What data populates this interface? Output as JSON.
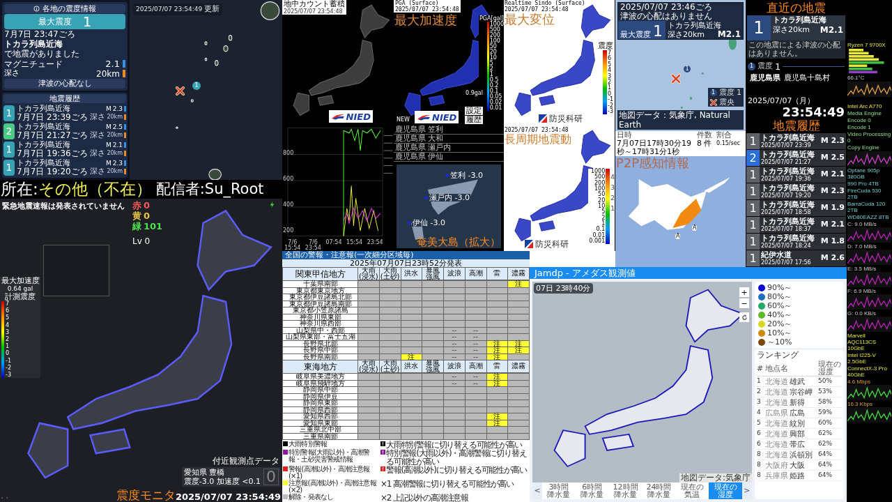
{
  "quake_panel": {
    "header": "各地の震度情報",
    "max_intensity_label": "最大震度",
    "max_intensity": "1",
    "time": "7月7日 23:47ごろ",
    "region": "トカラ列島近海",
    "note": "で地震がありました",
    "magnitude_label": "マグニチュード",
    "magnitude": "2.1",
    "depth_label": "深さ",
    "depth": "20km",
    "tsunami": "津波の心配なし",
    "history_header": "地震履歴",
    "history": [
      {
        "intensity": "1",
        "color": "#37a3b5",
        "region": "トカラ列島近海",
        "time": "7月7日 23:39ごろ",
        "depth_label": "深さ",
        "depth": "20km",
        "magnitude_label": "M",
        "magnitude": "2.3"
      },
      {
        "intensity": "2",
        "color": "#4cc985",
        "region": "トカラ列島近海",
        "time": "7月7日 21:27ごろ",
        "depth_label": "深さ",
        "depth": "20km",
        "magnitude_label": "M",
        "magnitude": "2.5"
      },
      {
        "intensity": "1",
        "color": "#37a3b5",
        "region": "トカラ列島近海",
        "time": "7月7日 19:36ごろ",
        "depth_label": "深さ",
        "depth": "20km",
        "magnitude_label": "M",
        "magnitude": "2.1"
      },
      {
        "intensity": "1",
        "color": "#37a3b5",
        "region": "トカラ列島近海",
        "time": "7月7日 19:20ごろ",
        "depth_label": "深さ",
        "depth": "20km",
        "magnitude_label": "M",
        "magnitude": "2.3"
      }
    ],
    "map_timestamp": "2025/07/07 23:54:49",
    "map_timestamp_suffix": "更新",
    "station_marker": "1"
  },
  "banner": {
    "label": "所在:",
    "status": "その他（不在）",
    "streamer": "配信者:Su_Root"
  },
  "shindo_monitor": {
    "eew_status": "緊急地震速報は発表されていません",
    "counts": [
      {
        "label": "赤",
        "value": "0",
        "color": "#ff5a5a"
      },
      {
        "label": "黄",
        "value": "0",
        "color": "#e8c547"
      },
      {
        "label": "緑",
        "value": "101",
        "color": "#4ee04e"
      }
    ],
    "level": "Lv 0",
    "max_accel_label": "最大加速度",
    "max_accel": "0.64 gal",
    "scale_label": "計測震度",
    "scale_ticks": [
      "7",
      "6",
      "5",
      "4",
      "3",
      "2",
      "1",
      "0",
      "-1",
      "-2",
      "-3"
    ],
    "nearby_label": "付近観測点データ",
    "nearby_station": "愛知県 豊橋",
    "nearby_values": "震度-3.0 加速度 <0.1",
    "nearby_intensity": "0",
    "title": "震度モニタ",
    "timestamp": "2025/07/07 23:54:49"
  },
  "underground_count": {
    "title": "地中カウント蓄積",
    "timestamp": "2025/07/07 23:54:48",
    "logo": "NIED",
    "graph_yticks": [
      "800",
      "600",
      "400",
      "200"
    ],
    "graph_xticks": [
      "7/6 15:54",
      "7/6 23:54",
      "07:54",
      "15:54",
      "23:54"
    ]
  },
  "pga": {
    "header": "PGA (Surface)",
    "timestamp": "2025/07/07 23:54:48",
    "title": "最大加速度",
    "legend_title": "PGA[gal]",
    "legend_ticks": [
      "1000",
      "500",
      "200",
      "100",
      "50",
      "20",
      "10",
      "5",
      "2",
      "1",
      "0.5",
      "0.2",
      "0.1",
      "0.05",
      "0.02",
      "0.01"
    ],
    "reading": "0.9gal",
    "new_label": "NEW",
    "buttons": [
      "設定",
      "履歴"
    ],
    "logo": "NIED"
  },
  "amami": {
    "stations": [
      "鹿児島県 笠利",
      "鹿児島県 大和",
      "鹿児島県 瀬戸内",
      "鹿児島県 伊仙"
    ],
    "map_labels": [
      "笠利 -3.0",
      "瀬戸内 -3.0",
      "伊仙 -3.0"
    ],
    "title": "奄美大島（拡大）"
  },
  "realtime_sindo": {
    "header": "Realtime Sindo (Surface)",
    "timestamp": "2025/07/07 23:54:48",
    "title": "最大変位",
    "legend_title": "震度",
    "legend_ticks": [
      "7",
      "6",
      "5",
      "4",
      "3",
      "2",
      "1",
      "0",
      "-1",
      "-2",
      "-3"
    ],
    "logo": "防災科研"
  },
  "long_period": {
    "timestamp": "2025/07/07 23:54:48",
    "title": "長周期地震動",
    "legend_ticks": [
      "1000",
      "500",
      "200",
      "100",
      "50",
      "20",
      "10",
      "5",
      "2",
      "1",
      "0.1",
      "0.01",
      "0.001"
    ],
    "class_ticks": [
      "4",
      "3",
      "2",
      "1"
    ],
    "logo": "防災科研"
  },
  "epicenter_map": {
    "time": "2025/07/07 23:46ごろ",
    "tsunami": "津波の心配はありません",
    "max_intensity_label": "最大震度",
    "max_intensity": "1",
    "region": "トカラ列島近海",
    "depth": "深さ20km",
    "magnitude": "M2.1",
    "station_marker": "1",
    "legend": [
      {
        "kind": "intensity",
        "marker": "1",
        "label": "震度 1"
      },
      {
        "kind": "epicenter",
        "label": "震央"
      }
    ],
    "attribution": "地図データ：気象庁, Natural Earth"
  },
  "p2p": {
    "columns": [
      "日時",
      "件数",
      "割合"
    ],
    "values": [
      "7月07日17時30分19秒～17時31分1秒",
      "8 件",
      "0.15/sec"
    ],
    "title": "P2P感知情報",
    "markers": [
      "A",
      "A"
    ]
  },
  "recent": {
    "title": "直近の地震",
    "intensity": "1",
    "region": "トカラ列島近海",
    "depth": "深さ20km",
    "magnitude": "M2.1",
    "message": "この地震による津波の心配はありません。",
    "area": {
      "marker": "1",
      "label": "震度",
      "intensity": "1",
      "prefecture": "鹿児島県",
      "city": "鹿児島十島村"
    },
    "date": "2025/07/07（月）",
    "time": "23:54:49",
    "history_title": "地震履歴",
    "history": [
      {
        "intensity": "1",
        "color": "#5f6368",
        "region": "トカラ列島近海",
        "datetime": "2025/07/07 23:39",
        "magnitude": "M 2.3"
      },
      {
        "intensity": "2",
        "color": "#2a6fd6",
        "region": "トカラ列島近海",
        "datetime": "2025/07/07 21:27",
        "magnitude": "M 2.5"
      },
      {
        "intensity": "1",
        "color": "#5f6368",
        "region": "トカラ列島近海",
        "datetime": "2025/07/07 19:36",
        "magnitude": "M 2.1"
      },
      {
        "intensity": "1",
        "color": "#5f6368",
        "region": "トカラ列島近海",
        "datetime": "2025/07/07 19:20",
        "magnitude": "M 2.3"
      },
      {
        "intensity": "1",
        "color": "#5f6368",
        "region": "トカラ列島近海",
        "datetime": "2025/07/07 18:58",
        "magnitude": "M 1.9"
      },
      {
        "intensity": "1",
        "color": "#5f6368",
        "region": "トカラ列島近海",
        "datetime": "2025/07/07 18:37",
        "magnitude": "M 2.1"
      },
      {
        "intensity": "1",
        "color": "#5f6368",
        "region": "トカラ列島近海",
        "datetime": "2025/07/07 18:24",
        "magnitude": "M 1.8"
      },
      {
        "intensity": "1",
        "color": "#5f6368",
        "region": "紀伊水道",
        "datetime": "2025/07/07 17:56",
        "magnitude": "M 2.6"
      }
    ]
  },
  "system_monitor": {
    "cpu": "Ryzen 7 9700X",
    "cpu_temp": "66.1°C",
    "gpu": "Intel Arc A770",
    "gpu_engines": [
      "Media Engine",
      "Encode 0",
      "Encode 1",
      "Video Processing 0",
      "Copy Engine"
    ],
    "drives": [
      "Optane 905p 380GB",
      "990 Pro 4TB",
      "FireCuda 530 2TB",
      "BarraCuda 120 2TB",
      "WD80EAZZ 8TB"
    ],
    "disk_rates": [
      "C: 9.0 MB/s",
      "D: 7.0 MB/s",
      "E: 3.5 MB/s",
      "F: 6.9 MB/s",
      "G: 0.0 KB/s"
    ],
    "nics": [
      "Marvell AQC113CS 10GbE",
      "Intel I225-V 2.5GbE",
      "ConnectX-3 Pro 40GbE"
    ],
    "net_rates": [
      "4.6 Mbps",
      "16.3 Kbps"
    ]
  },
  "warnings": {
    "title": "全国の警報・注意報(一次細分区域毎)",
    "issued": "2025年07月07日23時52分発表",
    "sections": [
      {
        "name": "関東甲信地方",
        "columns": [
          {
            "top": "大雨",
            "bottom": "(浸水)"
          },
          {
            "top": "大雨",
            "bottom": "(土砂)"
          },
          {
            "top": "洪水"
          },
          {
            "top": "暴風",
            "bottom": "強風"
          },
          {
            "top": "波浪"
          },
          {
            "top": "高潮"
          },
          {
            "top": "雷"
          },
          {
            "top": "濃霧"
          }
        ],
        "rows": [
          {
            "name": "千葉県南部",
            "cells": [
              {
                "kind": "none"
              },
              {
                "kind": "none"
              },
              {
                "kind": "none"
              },
              {
                "kind": "none"
              },
              {
                "kind": "none"
              },
              {
                "kind": "none"
              },
              {
                "kind": "none"
              },
              {
                "kind": "advisory",
                "text": "注"
              }
            ]
          },
          {
            "name": "東京都東京地方",
            "cells": [
              {
                "kind": "none"
              },
              {
                "kind": "none"
              },
              {
                "kind": "none"
              },
              {
                "kind": "none"
              },
              {
                "kind": "none"
              },
              {
                "kind": "none"
              },
              {
                "kind": "none"
              },
              {
                "kind": "none"
              }
            ]
          },
          {
            "name": "東京都伊豆諸島北部",
            "cells": [
              {
                "kind": "none"
              },
              {
                "kind": "none"
              },
              {
                "kind": "none"
              },
              {
                "kind": "none"
              },
              {
                "kind": "none"
              },
              {
                "kind": "none"
              },
              {
                "kind": "none"
              },
              {
                "kind": "none"
              }
            ]
          },
          {
            "name": "東京都伊豆諸島南部",
            "cells": [
              {
                "kind": "none"
              },
              {
                "kind": "none"
              },
              {
                "kind": "none"
              },
              {
                "kind": "none"
              },
              {
                "kind": "none"
              },
              {
                "kind": "none"
              },
              {
                "kind": "none"
              },
              {
                "kind": "none"
              }
            ]
          },
          {
            "name": "東京都小笠原諸島",
            "cells": [
              {
                "kind": "none"
              },
              {
                "kind": "none"
              },
              {
                "kind": "none"
              },
              {
                "kind": "none"
              },
              {
                "kind": "none"
              },
              {
                "kind": "none"
              },
              {
                "kind": "none"
              },
              {
                "kind": "none"
              }
            ]
          },
          {
            "name": "神奈川県東部",
            "cells": [
              {
                "kind": "none"
              },
              {
                "kind": "none"
              },
              {
                "kind": "none"
              },
              {
                "kind": "none"
              },
              {
                "kind": "none"
              },
              {
                "kind": "none"
              },
              {
                "kind": "none"
              },
              {
                "kind": "none"
              }
            ]
          },
          {
            "name": "神奈川県西部",
            "cells": [
              {
                "kind": "none"
              },
              {
                "kind": "none"
              },
              {
                "kind": "none"
              },
              {
                "kind": "none"
              },
              {
                "kind": "none"
              },
              {
                "kind": "none"
              },
              {
                "kind": "none"
              },
              {
                "kind": "none"
              }
            ]
          },
          {
            "name": "山梨県中・西部",
            "cells": [
              {
                "kind": "none"
              },
              {
                "kind": "none"
              },
              {
                "kind": "none"
              },
              {
                "kind": "none"
              },
              {
                "kind": "na",
                "text": "--"
              },
              {
                "kind": "na",
                "text": "--"
              },
              {
                "kind": "none"
              },
              {
                "kind": "none"
              }
            ]
          },
          {
            "name": "山梨県東部・富士五湖",
            "cells": [
              {
                "kind": "none"
              },
              {
                "kind": "none"
              },
              {
                "kind": "none"
              },
              {
                "kind": "none"
              },
              {
                "kind": "na",
                "text": "--"
              },
              {
                "kind": "na",
                "text": "--"
              },
              {
                "kind": "none"
              },
              {
                "kind": "none"
              }
            ]
          },
          {
            "name": "長野県北部",
            "cells": [
              {
                "kind": "none"
              },
              {
                "kind": "none"
              },
              {
                "kind": "none"
              },
              {
                "kind": "none"
              },
              {
                "kind": "na",
                "text": "--"
              },
              {
                "kind": "na",
                "text": "--"
              },
              {
                "kind": "advisory",
                "text": "注"
              },
              {
                "kind": "advisory",
                "text": "注"
              }
            ]
          },
          {
            "name": "長野県中部",
            "cells": [
              {
                "kind": "none"
              },
              {
                "kind": "none"
              },
              {
                "kind": "none"
              },
              {
                "kind": "none"
              },
              {
                "kind": "na",
                "text": "--"
              },
              {
                "kind": "na",
                "text": "--"
              },
              {
                "kind": "advisory",
                "text": "注"
              },
              {
                "kind": "advisory",
                "text": "注"
              }
            ]
          },
          {
            "name": "長野県南部",
            "cells": [
              {
                "kind": "none"
              },
              {
                "kind": "none"
              },
              {
                "kind": "advisory",
                "text": "注"
              },
              {
                "kind": "none"
              },
              {
                "kind": "na",
                "text": "--"
              },
              {
                "kind": "na",
                "text": "--"
              },
              {
                "kind": "advisory",
                "text": "注"
              },
              {
                "kind": "none"
              }
            ]
          }
        ]
      },
      {
        "name": "東海地方",
        "columns": [
          {
            "top": "大雨",
            "bottom": "(浸水)"
          },
          {
            "top": "大雨",
            "bottom": "(土砂)"
          },
          {
            "top": "洪水"
          },
          {
            "top": "暴風",
            "bottom": "強風"
          },
          {
            "top": "波浪"
          },
          {
            "top": "高潮"
          },
          {
            "top": "雷"
          },
          {
            "top": "濃霧"
          }
        ],
        "rows": [
          {
            "name": "岐阜県美濃地方",
            "cells": [
              {
                "kind": "none"
              },
              {
                "kind": "none"
              },
              {
                "kind": "none"
              },
              {
                "kind": "none"
              },
              {
                "kind": "na",
                "text": "--"
              },
              {
                "kind": "na",
                "text": "--"
              },
              {
                "kind": "advisory",
                "text": "注"
              },
              {
                "kind": "none"
              }
            ]
          },
          {
            "name": "岐阜県飛騨地方",
            "cells": [
              {
                "kind": "none"
              },
              {
                "kind": "none"
              },
              {
                "kind": "none"
              },
              {
                "kind": "none"
              },
              {
                "kind": "na",
                "text": "--"
              },
              {
                "kind": "na",
                "text": "--"
              },
              {
                "kind": "advisory",
                "text": "注"
              },
              {
                "kind": "none"
              }
            ]
          },
          {
            "name": "静岡県中部",
            "cells": [
              {
                "kind": "none"
              },
              {
                "kind": "none"
              },
              {
                "kind": "none"
              },
              {
                "kind": "none"
              },
              {
                "kind": "none"
              },
              {
                "kind": "none"
              },
              {
                "kind": "none"
              },
              {
                "kind": "none"
              }
            ]
          },
          {
            "name": "静岡県伊豆",
            "cells": [
              {
                "kind": "none"
              },
              {
                "kind": "none"
              },
              {
                "kind": "none"
              },
              {
                "kind": "none"
              },
              {
                "kind": "none"
              },
              {
                "kind": "none"
              },
              {
                "kind": "none"
              },
              {
                "kind": "none"
              }
            ]
          },
          {
            "name": "静岡県東部",
            "cells": [
              {
                "kind": "none"
              },
              {
                "kind": "none"
              },
              {
                "kind": "none"
              },
              {
                "kind": "none"
              },
              {
                "kind": "none"
              },
              {
                "kind": "none"
              },
              {
                "kind": "none"
              },
              {
                "kind": "none"
              }
            ]
          },
          {
            "name": "静岡県西部",
            "cells": [
              {
                "kind": "none"
              },
              {
                "kind": "none"
              },
              {
                "kind": "none"
              },
              {
                "kind": "none"
              },
              {
                "kind": "none"
              },
              {
                "kind": "none"
              },
              {
                "kind": "none"
              },
              {
                "kind": "none"
              }
            ]
          },
          {
            "name": "愛知県西部",
            "cells": [
              {
                "kind": "none"
              },
              {
                "kind": "none"
              },
              {
                "kind": "none"
              },
              {
                "kind": "none"
              },
              {
                "kind": "none"
              },
              {
                "kind": "none"
              },
              {
                "kind": "advisory",
                "text": "注"
              },
              {
                "kind": "none"
              }
            ]
          },
          {
            "name": "愛知県東部",
            "cells": [
              {
                "kind": "none"
              },
              {
                "kind": "none"
              },
              {
                "kind": "none"
              },
              {
                "kind": "none"
              },
              {
                "kind": "none"
              },
              {
                "kind": "none"
              },
              {
                "kind": "advisory",
                "text": "注"
              },
              {
                "kind": "none"
              }
            ]
          },
          {
            "name": "三重県北中部",
            "cells": [
              {
                "kind": "none"
              },
              {
                "kind": "none"
              },
              {
                "kind": "none"
              },
              {
                "kind": "none"
              },
              {
                "kind": "none"
              },
              {
                "kind": "none"
              },
              {
                "kind": "none"
              },
              {
                "kind": "none"
              }
            ]
          },
          {
            "name": "三重県南部",
            "cells": [
              {
                "kind": "none"
              },
              {
                "kind": "none"
              },
              {
                "kind": "none"
              },
              {
                "kind": "none"
              },
              {
                "kind": "none"
              },
              {
                "kind": "none"
              },
              {
                "kind": "none"
              },
              {
                "kind": "none"
              }
            ]
          }
        ]
      }
    ],
    "legend": [
      {
        "kind": "swatch",
        "color": "#000000",
        "text": "大雨特別警報"
      },
      {
        "kind": "mark",
        "color": "#000000",
        "text": "大雨特別警報に切り替える可能性が高い"
      },
      {
        "kind": "swatch",
        "color": "#8b1a9b",
        "text": "特別警報(大雨以外)・高潮警報・土砂災害警戒情報"
      },
      {
        "kind": "mark",
        "color": "#8b1a9b",
        "text": "特別警報(大雨以外)・高潮警報に切り替える可能性が高い"
      },
      {
        "kind": "swatch",
        "color": "#e02020",
        "text": "警報(高潮以外)・高潮注意報(×1)"
      },
      {
        "kind": "mark",
        "color": "#e02020",
        "text": "警報(高潮以外)に切り替える可能性が高い"
      },
      {
        "kind": "swatch",
        "color": "#ffff33",
        "text": "注意報(高潮以外)・高潮注意報(×2)"
      },
      {
        "kind": "note",
        "text": "×1 高潮警報に切り替える可能性が高い"
      },
      {
        "kind": "swatch",
        "color": "#bdbdbd",
        "text": "解除・発表なし"
      },
      {
        "kind": "note",
        "text": "×2 上記以外の高潮注意報"
      }
    ]
  },
  "jamdp": {
    "title": "Jamdp - アメダス観測値",
    "time": "07日 23時40分",
    "zoom_in": "+",
    "zoom_out": "−",
    "attribution": "地図データ:気象庁",
    "legend": [
      {
        "label": "90%～",
        "color": "#0a0ad0"
      },
      {
        "label": "80%～",
        "color": "#1f6fc0"
      },
      {
        "label": "60%～",
        "color": "#1fa86a"
      },
      {
        "label": "40%～",
        "color": "#5fb82a"
      },
      {
        "label": "20%～",
        "color": "#d8d820"
      },
      {
        "label": "10%～",
        "color": "#d08a10"
      },
      {
        "label": "～10%",
        "color": "#7a4a10"
      }
    ],
    "ranking_title": "ランキング",
    "ranking_columns": [
      "#",
      "地点名",
      "現在の湿度"
    ],
    "ranking": [
      {
        "rank": "1",
        "prefecture": "北海道",
        "station": "雄武",
        "value": "50%"
      },
      {
        "rank": "2",
        "prefecture": "北海道",
        "station": "宗谷岬",
        "value": "53%"
      },
      {
        "rank": "3",
        "prefecture": "北海道",
        "station": "新得",
        "value": "58%"
      },
      {
        "rank": "4",
        "prefecture": "広島県",
        "station": "広島",
        "value": "59%"
      },
      {
        "rank": "5",
        "prefecture": "北海道",
        "station": "紋別",
        "value": "60%"
      },
      {
        "rank": "6",
        "prefecture": "北海道",
        "station": "興部",
        "value": "62%"
      },
      {
        "rank": "6",
        "prefecture": "北海道",
        "station": "帯広",
        "value": "62%"
      },
      {
        "rank": "8",
        "prefecture": "北海道",
        "station": "浜頓別",
        "value": "64%"
      },
      {
        "rank": "8",
        "prefecture": "大阪府",
        "station": "大阪",
        "value": "64%"
      },
      {
        "rank": "8",
        "prefecture": "兵庫県",
        "station": "姫路",
        "value": "64%"
      }
    ],
    "prev": "<",
    "next": ">",
    "tabs": [
      {
        "lines": [
          "3時間",
          "降水量"
        ],
        "selected": false
      },
      {
        "lines": [
          "6時間",
          "降水量"
        ],
        "selected": false
      },
      {
        "lines": [
          "12時間",
          "降水量"
        ],
        "selected": false
      },
      {
        "lines": [
          "24時間",
          "降水量"
        ],
        "selected": false
      },
      {
        "lines": [
          "現在の",
          "気温"
        ],
        "selected": false
      },
      {
        "lines": [
          "現在の",
          "湿度"
        ],
        "selected": true
      }
    ]
  }
}
